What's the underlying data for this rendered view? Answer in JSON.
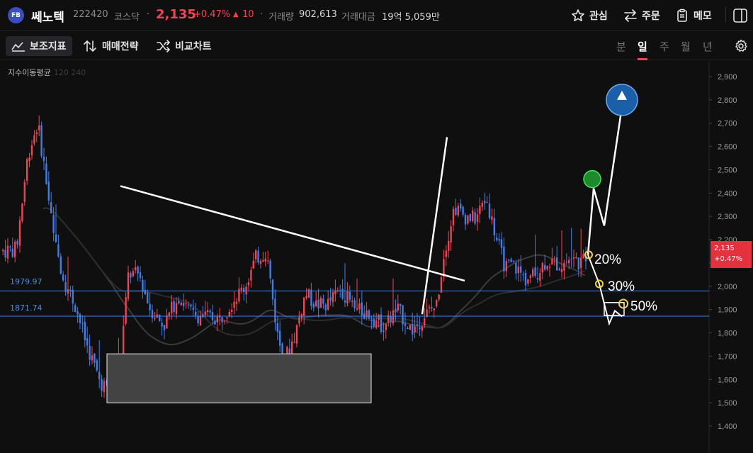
{
  "stock": {
    "logo_text": "FB",
    "name": "쎄노텍",
    "code": "222420",
    "market": "코스닥",
    "price": "2,135",
    "change_pct": "+0.47%",
    "change_arrow": "▲",
    "change_abs": "10",
    "volume_label": "거래량",
    "volume": "902,613",
    "amount_label": "거래대금",
    "amount": "19억 5,059만"
  },
  "top_actions": {
    "watch": "관심",
    "order": "주문",
    "memo": "메모"
  },
  "toolbar": {
    "indicators": "보조지표",
    "strategy": "매매전략",
    "compare": "비교차트"
  },
  "periods": [
    "분",
    "일",
    "주",
    "월",
    "년"
  ],
  "active_period": "일",
  "chart_data": {
    "type": "candlestick",
    "indicator_label": "지수이동평균",
    "indicator_faint": "120 240",
    "y_ticks": [
      "2,900",
      "2,800",
      "2,700",
      "2,600",
      "2,500",
      "2,400",
      "2,300",
      "2,200",
      "2,100",
      "2,000",
      "1,900",
      "1,800",
      "1,700",
      "1,600",
      "1,500",
      "1,400"
    ],
    "ylim": [
      1380,
      2950
    ],
    "horizontal_levels": [
      {
        "label": "1979.97",
        "value": 1979.97
      },
      {
        "label": "1871.74",
        "value": 1871.74
      }
    ],
    "current_price": "2,135",
    "current_change": "+0.47%",
    "annotations": [
      "20%",
      "30%",
      "50%"
    ],
    "colors": {
      "up": "#f04452",
      "down": "#3f7de8",
      "level": "#3d86e6"
    }
  }
}
